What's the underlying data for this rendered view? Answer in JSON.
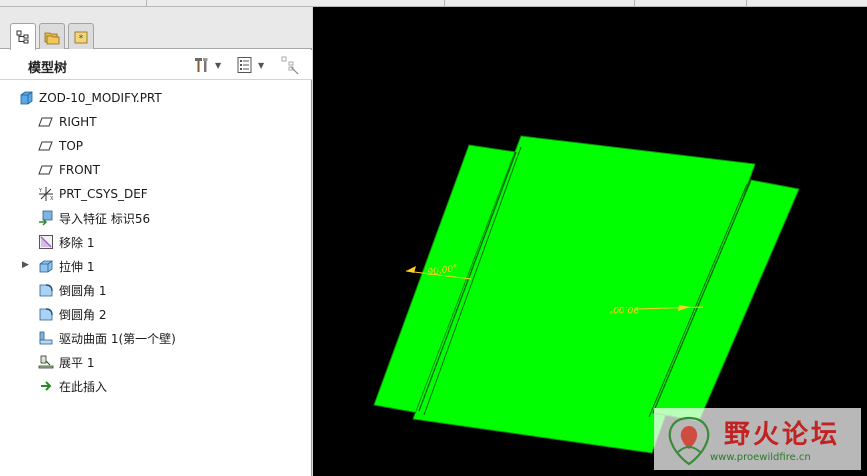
{
  "panel": {
    "title": "模型树",
    "tabs": [
      {
        "icon": "model-tree-icon"
      },
      {
        "icon": "folder-browser-icon"
      },
      {
        "icon": "favorites-icon"
      }
    ]
  },
  "tree": [
    {
      "label": "ZOD-10_MODIFY.PRT",
      "icon": "part-icon"
    },
    {
      "label": "RIGHT",
      "icon": "datum-plane-icon"
    },
    {
      "label": "TOP",
      "icon": "datum-plane-icon"
    },
    {
      "label": "FRONT",
      "icon": "datum-plane-icon"
    },
    {
      "label": "PRT_CSYS_DEF",
      "icon": "coordinate-system-icon"
    },
    {
      "label": "导入特征 标识56",
      "icon": "import-feature-icon"
    },
    {
      "label": "移除 1",
      "icon": "remove-icon"
    },
    {
      "label": "拉伸 1",
      "icon": "extrude-icon"
    },
    {
      "label": "倒圆角 1",
      "icon": "round-icon"
    },
    {
      "label": "倒圆角 2",
      "icon": "round-icon"
    },
    {
      "label": "驱动曲面 1(第一个壁)",
      "icon": "driving-surface-icon"
    },
    {
      "label": "展平 1",
      "icon": "flatten-icon"
    },
    {
      "label": "在此插入",
      "icon": "insert-here-arrow-icon"
    }
  ],
  "viewport": {
    "dimension_left": "90.00°",
    "dimension_right": "90.00°",
    "colors": {
      "background": "#000000",
      "part": "#00ff00",
      "dimension": "#ffd21f"
    }
  },
  "watermark": {
    "title": "野火论坛",
    "url": "www.proewildfire.cn"
  }
}
